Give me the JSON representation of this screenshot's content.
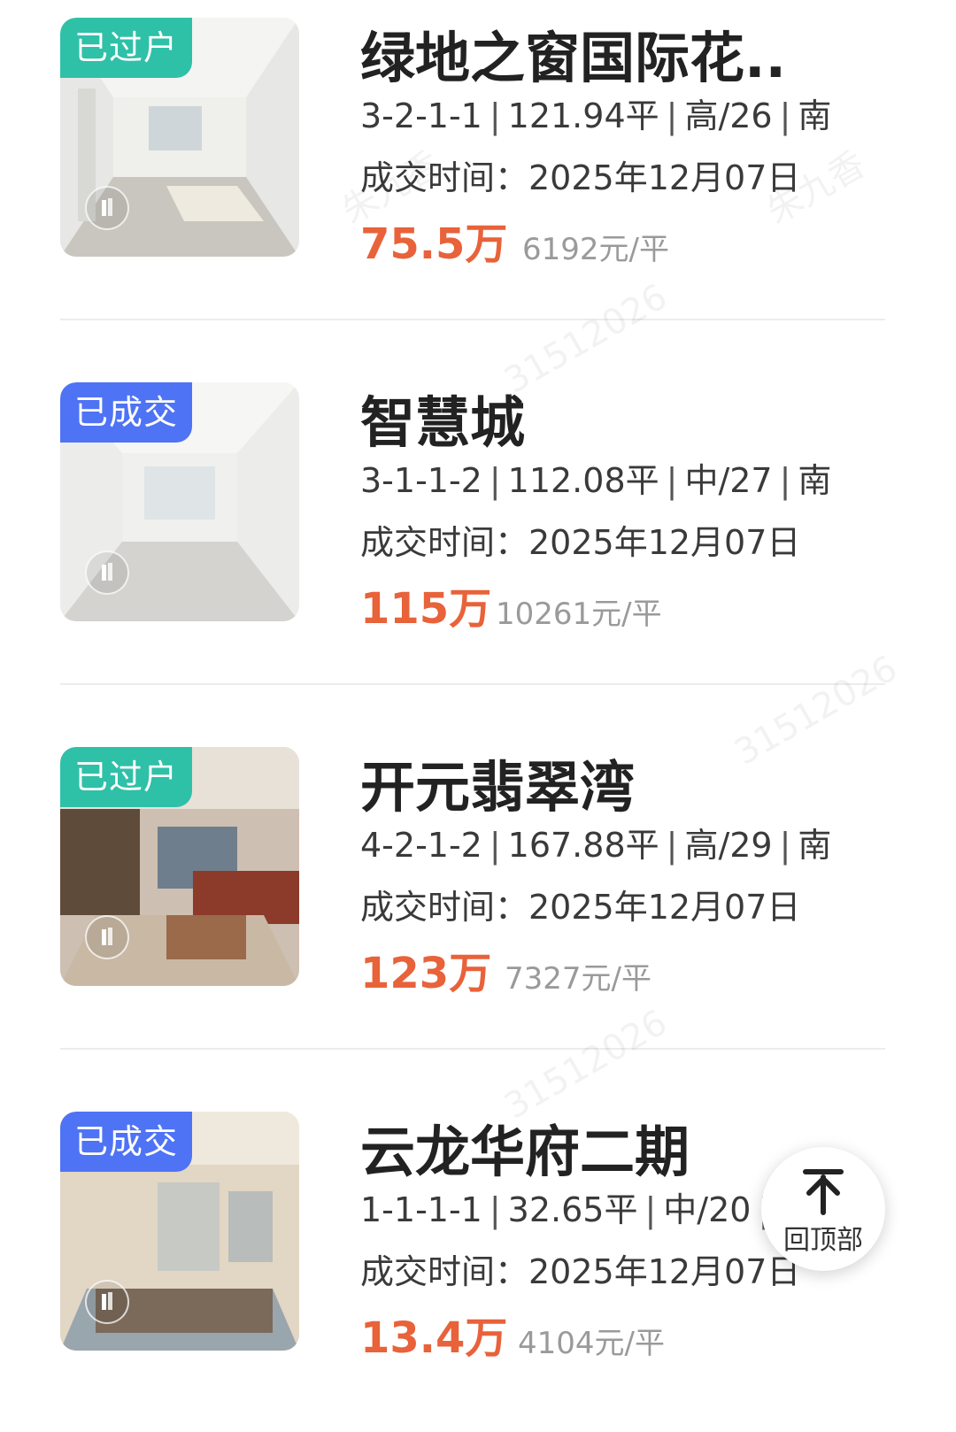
{
  "listings": [
    {
      "badge": "已过户",
      "badge_color": "#2fc0a8",
      "title": "绿地之窗国际花..",
      "layout": "3-2-1-1",
      "area": "121.94平",
      "floor": "高/26",
      "orientation": "南",
      "deal_time": "成交时间：2025年12月07日",
      "price": "75.5万",
      "unit_price": "6192元/平"
    },
    {
      "badge": "已成交",
      "badge_color": "#4f73f5",
      "title": "智慧城",
      "layout": "3-1-1-2",
      "area": "112.08平",
      "floor": "中/27",
      "orientation": "南",
      "deal_time": "成交时间：2025年12月07日",
      "price": "115万",
      "unit_price": "10261元/平"
    },
    {
      "badge": "已过户",
      "badge_color": "#2fc0a8",
      "title": "开元翡翠湾",
      "layout": "4-2-1-2",
      "area": "167.88平",
      "floor": "高/29",
      "orientation": "南",
      "deal_time": "成交时间：2025年12月07日",
      "price": "123万",
      "unit_price": "7327元/平"
    },
    {
      "badge": "已成交",
      "badge_color": "#4f73f5",
      "title": "云龙华府二期",
      "layout": "1-1-1-1",
      "area": "32.65平",
      "floor": "中/20",
      "orientation": "",
      "deal_time": "成交时间：2025年12月07日",
      "price": "13.4万",
      "unit_price": "4104元/平"
    }
  ],
  "back_to_top": {
    "label": "回顶部",
    "icon": "arrow-up-icon"
  },
  "watermark": {
    "name": "朱九香",
    "id": "31512026"
  },
  "colors": {
    "price": "#e8623a",
    "badge_transferred": "#2fc0a8",
    "badge_sold": "#4f73f5"
  }
}
